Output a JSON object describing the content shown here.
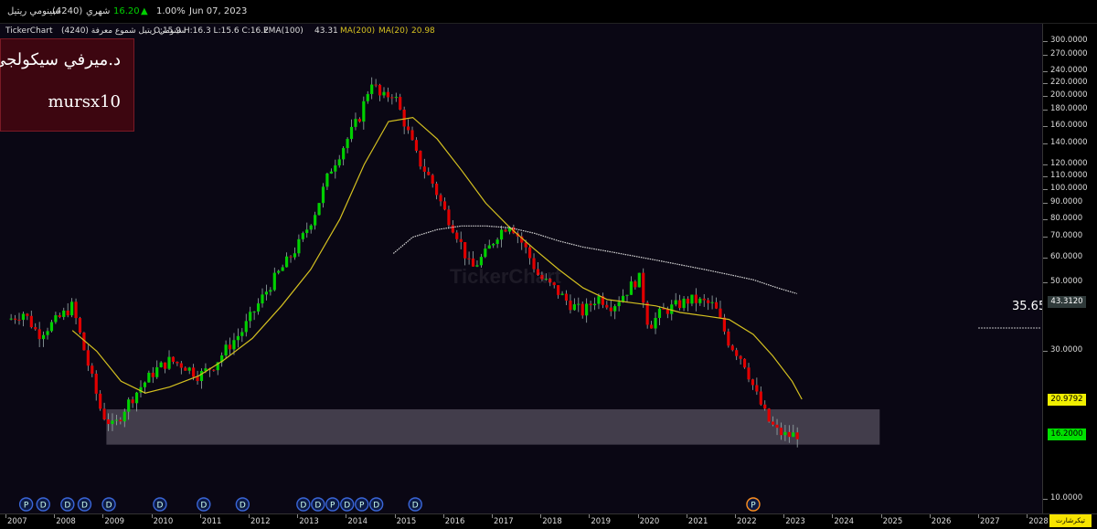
{
  "header": {
    "symbol_name": "سينومي ريتيل",
    "symbol_code": "(4240)",
    "period": "شهري",
    "price": "16.20",
    "change_pct": "1.00%",
    "date": "Jun 07, 2023"
  },
  "subheader": {
    "app": "TickerChart",
    "symbol_line": "سينومي ريتيل شموع معرفة (4240)",
    "ohlc": "O:15.9 H:16.3 L:15.6 C:16.2",
    "ema_label": "EMA(100)",
    "ema_value": "43.31",
    "ma200_label": "MA(200)",
    "ma20_label": "MA(20)",
    "ma_value": "20.98"
  },
  "label_box": {
    "line1": "د.ميرفي سيكولجي",
    "line2": "mursx10"
  },
  "watermark": "TickerChart",
  "brand": "تيكرشارت",
  "colors": {
    "up": "#00d000",
    "down": "#e00000",
    "ma20": "#d4c020",
    "ma200": "#d8d8d8",
    "ema_badge": "#2f3a3a",
    "ma_badge": "#f0ef00",
    "price_badge": "#00e000"
  },
  "chart_data": {
    "type": "candlestick",
    "scale": "log",
    "ylim": [
      9,
      310
    ],
    "y_ticks": [
      {
        "v": 300,
        "t": "300.0000"
      },
      {
        "v": 270,
        "t": "270.0000"
      },
      {
        "v": 240,
        "t": "240.0000"
      },
      {
        "v": 220,
        "t": "220.0000"
      },
      {
        "v": 200,
        "t": "200.0000"
      },
      {
        "v": 180,
        "t": "180.0000"
      },
      {
        "v": 160,
        "t": "160.0000"
      },
      {
        "v": 140,
        "t": "140.0000"
      },
      {
        "v": 120,
        "t": "120.0000"
      },
      {
        "v": 110,
        "t": "110.0000"
      },
      {
        "v": 100,
        "t": "100.0000"
      },
      {
        "v": 90,
        "t": "90.0000"
      },
      {
        "v": 80,
        "t": "80.0000"
      },
      {
        "v": 70,
        "t": "70.0000"
      },
      {
        "v": 60,
        "t": "60.0000"
      },
      {
        "v": 50,
        "t": "50.0000"
      },
      {
        "v": 30,
        "t": "30.0000"
      },
      {
        "v": 10,
        "t": "10.0000"
      }
    ],
    "x_years": [
      "2007",
      "2008",
      "2009",
      "2010",
      "2011",
      "2012",
      "2013",
      "2014",
      "2015",
      "2016",
      "2017",
      "2018",
      "2019",
      "2020",
      "2021",
      "2022",
      "2023",
      "2024",
      "2025",
      "2026",
      "2027",
      "2028"
    ],
    "anchors": [
      [
        2007.0,
        38
      ],
      [
        2007.3,
        40
      ],
      [
        2007.6,
        34
      ],
      [
        2008.0,
        38
      ],
      [
        2008.3,
        42
      ],
      [
        2008.6,
        28
      ],
      [
        2008.9,
        19
      ],
      [
        2009.15,
        17
      ],
      [
        2009.4,
        20
      ],
      [
        2009.7,
        23
      ],
      [
        2010.0,
        26
      ],
      [
        2010.3,
        28
      ],
      [
        2010.6,
        27
      ],
      [
        2010.9,
        25
      ],
      [
        2011.2,
        27
      ],
      [
        2011.5,
        31
      ],
      [
        2011.8,
        35
      ],
      [
        2012.1,
        42
      ],
      [
        2012.4,
        50
      ],
      [
        2012.7,
        58
      ],
      [
        2013.0,
        68
      ],
      [
        2013.3,
        85
      ],
      [
        2013.6,
        115
      ],
      [
        213.9,
        135
      ],
      [
        2014.2,
        170
      ],
      [
        2014.45,
        225
      ],
      [
        2014.65,
        195
      ],
      [
        2014.9,
        205
      ],
      [
        2015.15,
        160
      ],
      [
        2015.4,
        125
      ],
      [
        2015.7,
        105
      ],
      [
        2015.95,
        85
      ],
      [
        2016.2,
        72
      ],
      [
        2016.5,
        55
      ],
      [
        2016.8,
        62
      ],
      [
        2017.05,
        72
      ],
      [
        2017.3,
        78
      ],
      [
        2017.6,
        65
      ],
      [
        2017.9,
        52
      ],
      [
        2018.2,
        48
      ],
      [
        2018.5,
        43
      ],
      [
        2018.8,
        40
      ],
      [
        2019.1,
        45
      ],
      [
        2019.4,
        42
      ],
      [
        2019.7,
        47
      ],
      [
        2019.95,
        52
      ],
      [
        2020.15,
        36
      ],
      [
        2020.4,
        40
      ],
      [
        2020.7,
        42
      ],
      [
        2021.0,
        44
      ],
      [
        2021.3,
        43
      ],
      [
        2021.5,
        42
      ],
      [
        2021.8,
        32
      ],
      [
        2022.1,
        28
      ],
      [
        2022.35,
        22
      ],
      [
        2022.6,
        18
      ],
      [
        2022.8,
        16.5
      ],
      [
        2023.0,
        16
      ],
      [
        2023.2,
        16.2
      ]
    ],
    "ma20": [
      [
        2008.3,
        35
      ],
      [
        2008.8,
        30
      ],
      [
        2009.3,
        24
      ],
      [
        2009.8,
        22
      ],
      [
        2010.3,
        23
      ],
      [
        2010.9,
        25
      ],
      [
        2011.4,
        28
      ],
      [
        2012.0,
        33
      ],
      [
        2012.6,
        42
      ],
      [
        2013.2,
        55
      ],
      [
        2013.8,
        80
      ],
      [
        2014.3,
        120
      ],
      [
        2014.8,
        165
      ],
      [
        2015.3,
        170
      ],
      [
        2015.8,
        145
      ],
      [
        2016.3,
        115
      ],
      [
        2016.8,
        90
      ],
      [
        2017.3,
        75
      ],
      [
        2017.8,
        64
      ],
      [
        2018.3,
        55
      ],
      [
        2018.8,
        48
      ],
      [
        2019.3,
        44
      ],
      [
        2019.8,
        43
      ],
      [
        2020.3,
        42
      ],
      [
        2020.8,
        40
      ],
      [
        2021.3,
        39
      ],
      [
        2021.8,
        38
      ],
      [
        2022.3,
        34
      ],
      [
        2022.7,
        29
      ],
      [
        2023.1,
        24
      ],
      [
        2023.3,
        21
      ]
    ],
    "ema100": [
      [
        2014.9,
        62
      ],
      [
        2015.3,
        70
      ],
      [
        2015.8,
        74
      ],
      [
        2016.3,
        76
      ],
      [
        2016.8,
        76
      ],
      [
        2017.3,
        75
      ],
      [
        2017.8,
        72
      ],
      [
        2018.3,
        68
      ],
      [
        2018.8,
        65
      ],
      [
        2019.3,
        63
      ],
      [
        2019.8,
        61
      ],
      [
        2020.3,
        59
      ],
      [
        2020.8,
        57
      ],
      [
        2021.3,
        55
      ],
      [
        2021.8,
        53
      ],
      [
        2022.3,
        51
      ],
      [
        2022.8,
        48
      ],
      [
        2023.2,
        46
      ]
    ],
    "zone": {
      "x0": 2009.0,
      "x1": 2024.9,
      "y0": 15,
      "y1": 19.5
    },
    "ref_line": {
      "value": 35.65,
      "label": "35.65"
    },
    "badges": [
      {
        "value": 43.312,
        "label": "43.3120"
      },
      {
        "value": 20.9792,
        "label": "20.9792"
      },
      {
        "value": 16.2,
        "label": "16.2000"
      }
    ],
    "events": [
      "P",
      "D",
      "D",
      "D",
      "D",
      "D",
      "D",
      "D",
      "D",
      "D",
      "P",
      "D",
      "P",
      "D",
      "D",
      "P"
    ],
    "event_x": [
      2007.35,
      2007.7,
      2008.2,
      2008.55,
      2009.05,
      2010.1,
      2011.0,
      2011.8,
      2013.05,
      2013.35,
      2013.65,
      2013.95,
      2014.25,
      2014.55,
      2015.35,
      2022.3
    ]
  }
}
